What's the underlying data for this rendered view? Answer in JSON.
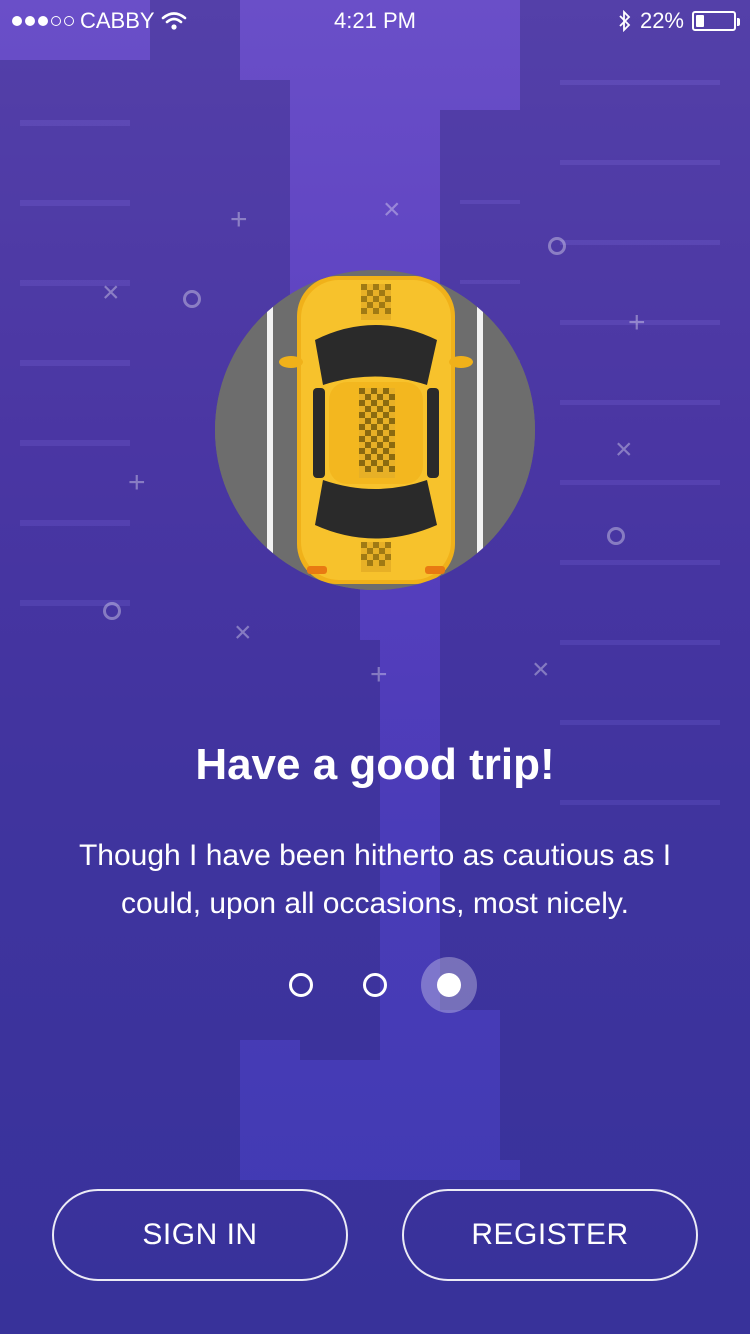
{
  "status_bar": {
    "carrier": "CABBY",
    "time": "4:21 PM",
    "battery_percent": "22%",
    "battery_level": 0.22,
    "signal_dots_filled": 3,
    "signal_dots_total": 5
  },
  "onboarding": {
    "title": "Have a good trip!",
    "subtitle": "Though I have been hitherto as cautious as I could, upon all occasions, most nicely.",
    "pages_total": 3,
    "active_page": 3
  },
  "actions": {
    "sign_in_label": "SIGN IN",
    "register_label": "REGISTER"
  },
  "colors": {
    "background_top": "#6a4fc8",
    "background_bottom": "#3f3ab2",
    "taxi_yellow": "#f5b915",
    "road_gray": "#6b6b6b"
  },
  "icons": {
    "wifi": "wifi-icon",
    "bluetooth": "bluetooth-icon",
    "battery": "battery-icon",
    "taxi": "taxi-car-icon"
  }
}
